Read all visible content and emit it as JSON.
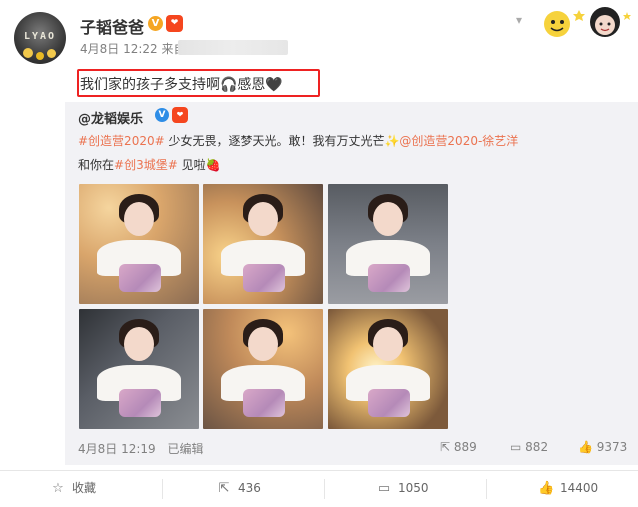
{
  "post": {
    "username": "子韬爸爸",
    "avatar_text": "LYAO",
    "date": "4月8日",
    "time": "12:22",
    "source_prefix": "来自",
    "status_text": "我们家的孩子多支持啊🎧感恩🖤"
  },
  "repost": {
    "author": "@龙韬娱乐",
    "line1_tag": "#创造营2020#",
    "line1_text": " 少女无畏，逐梦天光。敢！我有万丈光芒✨",
    "line1_mention": "@创造营2020-徐艺洋",
    "line2_prefix": "和你在",
    "line2_tag": "#创3城堡#",
    "line2_suffix": " 见啦🍓",
    "date": "4月8日",
    "time": "12:19",
    "edited": "已编辑",
    "share_count": "889",
    "comment_count": "882",
    "like_count": "9373"
  },
  "actions": {
    "favorite": "收藏",
    "share": "436",
    "comment": "1050",
    "like": "14400"
  },
  "icons": {
    "dropdown": "chevron-down-icon",
    "verified": "verified-badge-icon",
    "star": "star-icon",
    "share": "share-icon",
    "comment": "comment-icon",
    "like": "thumbs-up-icon"
  },
  "colors": {
    "highlight": "#ee2222",
    "hashtag": "#eb7350",
    "verified_orange": "#f5a623",
    "verified_blue": "#2e8de6",
    "repost_bg": "#f2f2f5"
  }
}
